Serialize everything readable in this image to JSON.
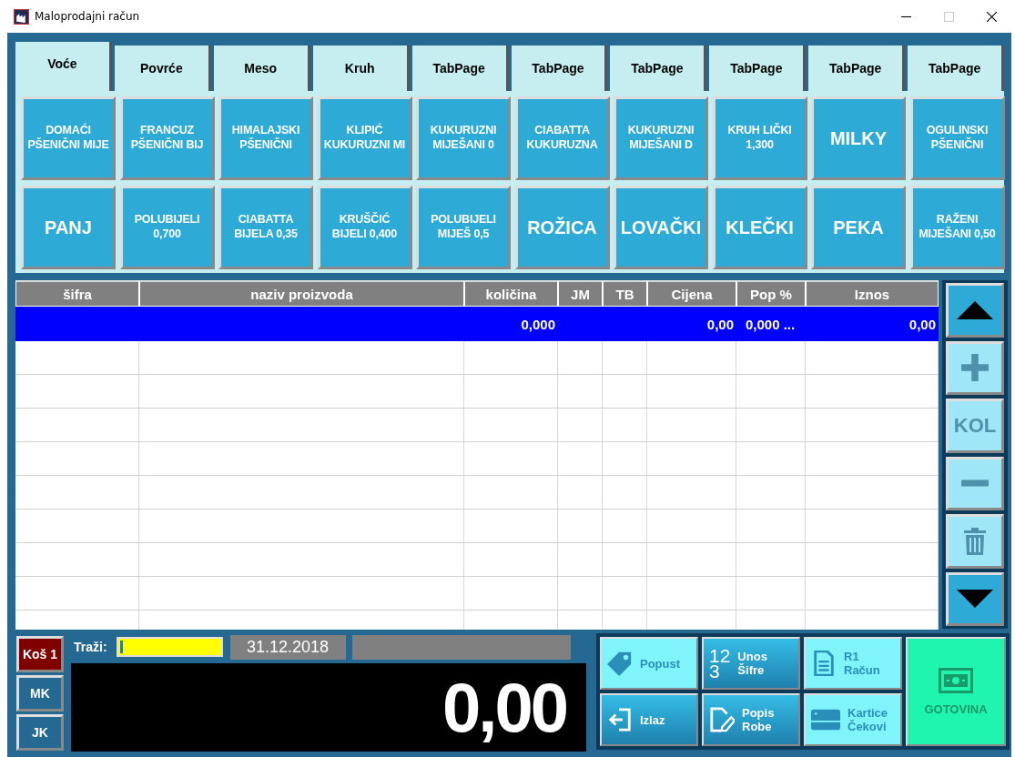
{
  "window": {
    "title": "Maloprodajni račun"
  },
  "tabs": [
    {
      "label": "Voće",
      "selected": true
    },
    {
      "label": "Povrće",
      "selected": false
    },
    {
      "label": "Meso",
      "selected": false
    },
    {
      "label": "Kruh",
      "selected": false
    },
    {
      "label": "TabPage",
      "selected": false
    },
    {
      "label": "TabPage",
      "selected": false
    },
    {
      "label": "TabPage",
      "selected": false
    },
    {
      "label": "TabPage",
      "selected": false
    },
    {
      "label": "TabPage",
      "selected": false
    },
    {
      "label": "TabPage",
      "selected": false
    }
  ],
  "products": [
    {
      "lines": [
        "DOMAĆI",
        "PŠENIČNI MIJE"
      ],
      "kind": "small"
    },
    {
      "lines": [
        "FRANCUZ",
        "PŠENIČNI BIJ"
      ],
      "kind": "small"
    },
    {
      "lines": [
        "HIMALAJSKI",
        "PŠENIČNI"
      ],
      "kind": "small"
    },
    {
      "lines": [
        "KLIPIĆ",
        "KUKURUZNI MI"
      ],
      "kind": "small"
    },
    {
      "lines": [
        "KUKURUZNI",
        "MIJEŠANI 0"
      ],
      "kind": "small"
    },
    {
      "lines": [
        "CIABATTA",
        "KUKURUZNA"
      ],
      "kind": "small"
    },
    {
      "lines": [
        "KUKURUZNI",
        "MIJEŠANI D"
      ],
      "kind": "small"
    },
    {
      "lines": [
        "KRUH LIČKI",
        "1,300"
      ],
      "kind": "small"
    },
    {
      "lines": [
        "MILKY"
      ],
      "kind": "big"
    },
    {
      "lines": [
        "OGULINSKI",
        "PŠENIČNI"
      ],
      "kind": "small"
    },
    {
      "lines": [
        "PANJ"
      ],
      "kind": "big"
    },
    {
      "lines": [
        "POLUBIJELI",
        "0,700"
      ],
      "kind": "small"
    },
    {
      "lines": [
        "CIABATTA",
        "BIJELA 0,35"
      ],
      "kind": "small"
    },
    {
      "lines": [
        "KRUŠČIĆ",
        "BIJELI 0,400"
      ],
      "kind": "small"
    },
    {
      "lines": [
        "POLUBIJELI",
        "MIJEŠ 0,5"
      ],
      "kind": "small"
    },
    {
      "lines": [
        "ROŽICA"
      ],
      "kind": "big"
    },
    {
      "lines": [
        "LOVAČKI"
      ],
      "kind": "big"
    },
    {
      "lines": [
        "KLEČKI"
      ],
      "kind": "big"
    },
    {
      "lines": [
        "PEKA"
      ],
      "kind": "big"
    },
    {
      "lines": [
        "RAŽENI",
        "MIJEŠANI 0,50"
      ],
      "kind": "small"
    }
  ],
  "table": {
    "columns": [
      "šifra",
      "naziv proizvoda",
      "količina",
      "JM",
      "TB",
      "Cijena",
      "Pop %",
      "Iznos"
    ],
    "rows": [
      {
        "selected": true,
        "cells": [
          null,
          null,
          "0,000",
          null,
          null,
          "0,00",
          "0,000 ...",
          "0,00"
        ]
      }
    ]
  },
  "side_buttons": [
    {
      "kind": "up",
      "disabled": false
    },
    {
      "kind": "plus",
      "disabled": true
    },
    {
      "kind": "text",
      "label": "KOL",
      "disabled": true
    },
    {
      "kind": "minus",
      "disabled": true
    },
    {
      "kind": "trash",
      "disabled": true
    },
    {
      "kind": "down",
      "disabled": false
    }
  ],
  "baskets": [
    {
      "label": "Koš 1",
      "selected": true
    },
    {
      "label": "MK",
      "selected": false
    },
    {
      "label": "JK",
      "selected": false
    }
  ],
  "search": {
    "label": "Traži:"
  },
  "date": "31.12.2018",
  "total": "0,00",
  "actions": [
    {
      "kind": "tag",
      "lines": [
        "Popust"
      ],
      "disabled": true
    },
    {
      "kind": "numbers",
      "glyph": [
        "12",
        "3"
      ],
      "lines": [
        "Unos",
        "Šifre"
      ],
      "disabled": false
    },
    {
      "kind": "document",
      "lines": [
        "R1",
        "Račun"
      ],
      "disabled": true
    },
    {
      "kind": "exit",
      "lines": [
        "Izlaz"
      ],
      "disabled": false
    },
    {
      "kind": "edit",
      "lines": [
        "Popis",
        "Robe"
      ],
      "disabled": false
    },
    {
      "kind": "card",
      "lines": [
        "Kartice",
        "Čekovi"
      ],
      "disabled": true
    }
  ],
  "cash": {
    "label": "GOTOVINA"
  }
}
